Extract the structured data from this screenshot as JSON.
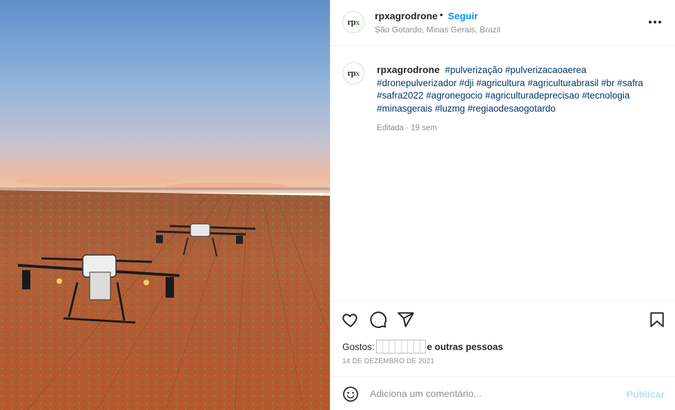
{
  "post": {
    "username": "rpxagrodrone",
    "separator": "•",
    "follow_label": "Seguir",
    "location": "São Gotardo, Minas Gerais, Brazil",
    "more_icon": "more-options-icon",
    "avatar_logo": {
      "text": "rp",
      "accent": "x"
    }
  },
  "caption": {
    "username": "rpxagrodrone",
    "hashtags": [
      "#pulverização",
      "#pulverizacaoaerea",
      "#dronepulverizador",
      "#dji",
      "#agricultura",
      "#agriculturabrasil",
      "#br",
      "#safra",
      "#safra2022",
      "#agronegocio",
      "#agriculturadeprecisao",
      "#tecnologia",
      "#minasgerais",
      "#luzmg",
      "#regiaodesaogotardo"
    ],
    "edited": "Editada",
    "meta_separator": "·",
    "age": "19 sem"
  },
  "actions": {
    "icons": [
      "heart-icon",
      "comment-icon",
      "share-icon",
      "bookmark-icon"
    ],
    "likes_prefix": "Gostos:",
    "likes_suffix": "e outras pessoas",
    "date": "14 DE DEZEMBRO DE 2021"
  },
  "comment": {
    "placeholder": "Adiciona um comentário...",
    "publish_label": "Publicar"
  },
  "colors": {
    "link_blue": "#0095f6",
    "hashtag": "#00376b",
    "muted": "#8e8e8e",
    "publish_disabled": "#b2dffc",
    "logo_green": "#2e9b3a"
  }
}
